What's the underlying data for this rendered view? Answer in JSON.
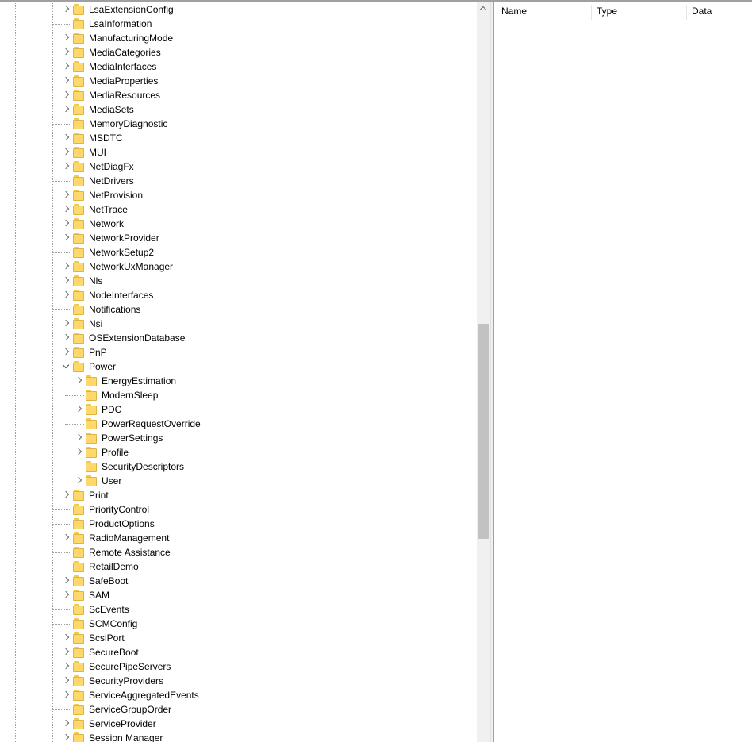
{
  "tree": {
    "items": [
      {
        "label": "LsaExtensionConfig",
        "level": 1,
        "expander": "collapsed"
      },
      {
        "label": "LsaInformation",
        "level": 1,
        "expander": "none"
      },
      {
        "label": "ManufacturingMode",
        "level": 1,
        "expander": "collapsed"
      },
      {
        "label": "MediaCategories",
        "level": 1,
        "expander": "collapsed"
      },
      {
        "label": "MediaInterfaces",
        "level": 1,
        "expander": "collapsed"
      },
      {
        "label": "MediaProperties",
        "level": 1,
        "expander": "collapsed"
      },
      {
        "label": "MediaResources",
        "level": 1,
        "expander": "collapsed"
      },
      {
        "label": "MediaSets",
        "level": 1,
        "expander": "collapsed"
      },
      {
        "label": "MemoryDiagnostic",
        "level": 1,
        "expander": "none"
      },
      {
        "label": "MSDTC",
        "level": 1,
        "expander": "collapsed"
      },
      {
        "label": "MUI",
        "level": 1,
        "expander": "collapsed"
      },
      {
        "label": "NetDiagFx",
        "level": 1,
        "expander": "collapsed"
      },
      {
        "label": "NetDrivers",
        "level": 1,
        "expander": "none"
      },
      {
        "label": "NetProvision",
        "level": 1,
        "expander": "collapsed"
      },
      {
        "label": "NetTrace",
        "level": 1,
        "expander": "collapsed"
      },
      {
        "label": "Network",
        "level": 1,
        "expander": "collapsed"
      },
      {
        "label": "NetworkProvider",
        "level": 1,
        "expander": "collapsed"
      },
      {
        "label": "NetworkSetup2",
        "level": 1,
        "expander": "none"
      },
      {
        "label": "NetworkUxManager",
        "level": 1,
        "expander": "collapsed"
      },
      {
        "label": "Nls",
        "level": 1,
        "expander": "collapsed"
      },
      {
        "label": "NodeInterfaces",
        "level": 1,
        "expander": "collapsed"
      },
      {
        "label": "Notifications",
        "level": 1,
        "expander": "none"
      },
      {
        "label": "Nsi",
        "level": 1,
        "expander": "collapsed"
      },
      {
        "label": "OSExtensionDatabase",
        "level": 1,
        "expander": "collapsed"
      },
      {
        "label": "PnP",
        "level": 1,
        "expander": "collapsed"
      },
      {
        "label": "Power",
        "level": 1,
        "expander": "expanded"
      },
      {
        "label": "EnergyEstimation",
        "level": 2,
        "expander": "collapsed"
      },
      {
        "label": "ModernSleep",
        "level": 2,
        "expander": "none"
      },
      {
        "label": "PDC",
        "level": 2,
        "expander": "collapsed"
      },
      {
        "label": "PowerRequestOverride",
        "level": 2,
        "expander": "none"
      },
      {
        "label": "PowerSettings",
        "level": 2,
        "expander": "collapsed"
      },
      {
        "label": "Profile",
        "level": 2,
        "expander": "collapsed"
      },
      {
        "label": "SecurityDescriptors",
        "level": 2,
        "expander": "none"
      },
      {
        "label": "User",
        "level": 2,
        "expander": "collapsed"
      },
      {
        "label": "Print",
        "level": 1,
        "expander": "collapsed"
      },
      {
        "label": "PriorityControl",
        "level": 1,
        "expander": "none"
      },
      {
        "label": "ProductOptions",
        "level": 1,
        "expander": "none"
      },
      {
        "label": "RadioManagement",
        "level": 1,
        "expander": "collapsed"
      },
      {
        "label": "Remote Assistance",
        "level": 1,
        "expander": "none"
      },
      {
        "label": "RetailDemo",
        "level": 1,
        "expander": "none"
      },
      {
        "label": "SafeBoot",
        "level": 1,
        "expander": "collapsed"
      },
      {
        "label": "SAM",
        "level": 1,
        "expander": "collapsed"
      },
      {
        "label": "ScEvents",
        "level": 1,
        "expander": "none"
      },
      {
        "label": "SCMConfig",
        "level": 1,
        "expander": "none"
      },
      {
        "label": "ScsiPort",
        "level": 1,
        "expander": "collapsed"
      },
      {
        "label": "SecureBoot",
        "level": 1,
        "expander": "collapsed"
      },
      {
        "label": "SecurePipeServers",
        "level": 1,
        "expander": "collapsed"
      },
      {
        "label": "SecurityProviders",
        "level": 1,
        "expander": "collapsed"
      },
      {
        "label": "ServiceAggregatedEvents",
        "level": 1,
        "expander": "collapsed"
      },
      {
        "label": "ServiceGroupOrder",
        "level": 1,
        "expander": "none"
      },
      {
        "label": "ServiceProvider",
        "level": 1,
        "expander": "collapsed"
      },
      {
        "label": "Session Manager",
        "level": 1,
        "expander": "collapsed"
      }
    ]
  },
  "list": {
    "columns": [
      "Name",
      "Type",
      "Data"
    ]
  },
  "icons": {
    "folder": "folder-icon",
    "collapsed": "chevron-right-icon",
    "expanded": "chevron-down-icon",
    "scroll_up": "chevron-up-icon"
  },
  "colors": {
    "folder_fill": "#ffd86a",
    "folder_edge": "#e0b24a",
    "tree_lines": "#a0a0a0",
    "scrollbar_thumb": "#c2c2c2"
  },
  "scroll": {
    "thumb_start_fraction": 0.435,
    "thumb_length_fraction": 0.29
  }
}
